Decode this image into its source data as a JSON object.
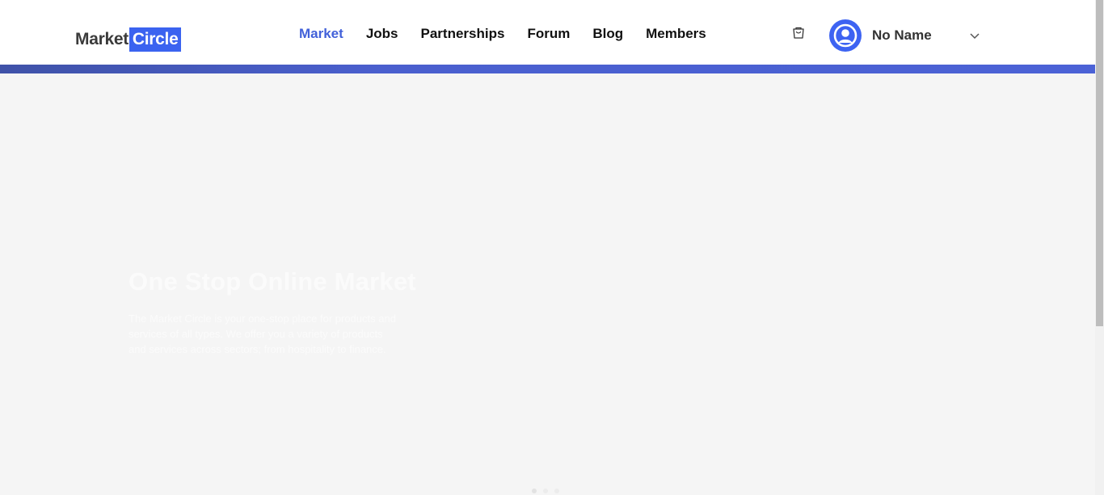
{
  "header": {
    "logo": {
      "part1": "Market",
      "part2": "Circle"
    },
    "nav": [
      {
        "label": "Market",
        "active": true
      },
      {
        "label": "Jobs",
        "active": false
      },
      {
        "label": "Partnerships",
        "active": false
      },
      {
        "label": "Forum",
        "active": false
      },
      {
        "label": "Blog",
        "active": false
      },
      {
        "label": "Members",
        "active": false
      }
    ],
    "cart_icon": "shopping-bag-icon",
    "user": {
      "name": "No Name",
      "avatar_icon": "user-circle-icon",
      "menu_icon": "chevron-down-icon"
    }
  },
  "hero": {
    "title": "One Stop Online Market",
    "description": "The Market Circle is your one-stop place for products and services of all types. We offer you a variety of products and services across sectors; from hospitality to finance."
  },
  "carousel": {
    "slides": 3,
    "active_index": 0
  },
  "colors": {
    "accent": "#4261d9",
    "brand_blue": "#3b63f0",
    "background": "#f5f5f5"
  }
}
